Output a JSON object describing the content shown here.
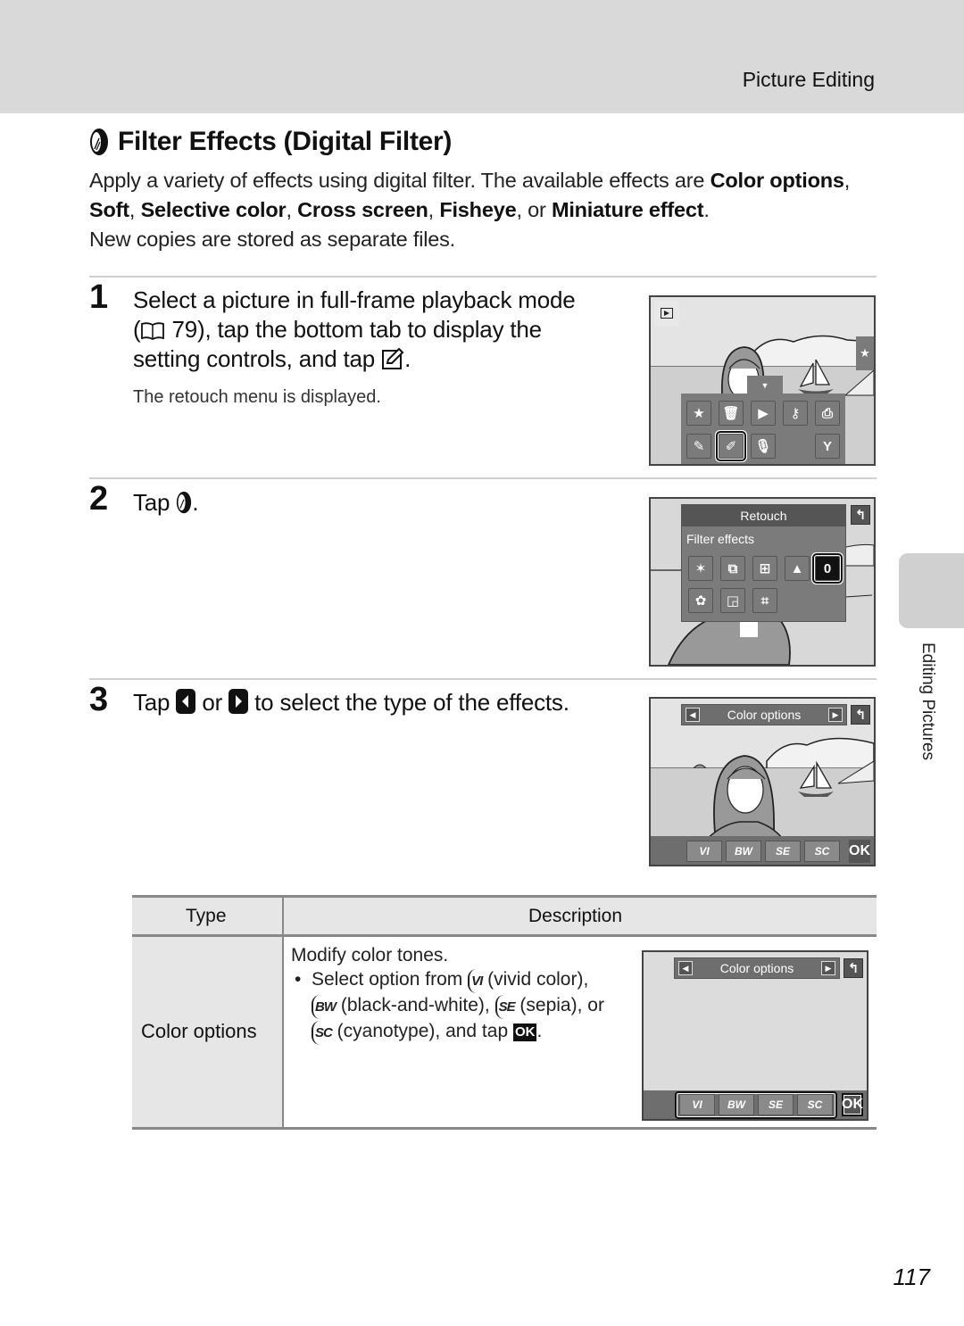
{
  "header": {
    "section_title": "Picture Editing"
  },
  "page_title": "Filter Effects (Digital Filter)",
  "intro": {
    "text_1": "Apply a variety of effects using digital filter. The available effects are ",
    "effect_1": "Color options",
    "sep_1": ", ",
    "effect_2": "Soft",
    "sep_2": ", ",
    "effect_3": "Selective color",
    "sep_3": ", ",
    "effect_4": "Cross screen",
    "sep_4": ", ",
    "effect_5": "Fisheye",
    "sep_5": ", or ",
    "effect_6": "Miniature effect",
    "end": ".",
    "text_2": "New copies are stored as separate files."
  },
  "steps": [
    {
      "number": "1",
      "line_1": "Select a picture in full-frame playback mode",
      "line_2_pre": "(",
      "line_2_ref": " 79), tap the bottom tab to display the",
      "line_3": "setting controls, and tap ",
      "line_3_end": ".",
      "note": "The retouch menu is displayed.",
      "screen": {
        "mode_icon": "playback-icon",
        "side_tab_icon": "star-icon",
        "menu_row_1": [
          "favorites-icon",
          "delete-icon",
          "slide-show-icon",
          "protect-icon",
          "print-order-icon"
        ],
        "menu_row_2": [
          "edit-icon",
          "retouch-icon",
          "voice-memo-icon",
          "setup-icon"
        ],
        "selected": "retouch-icon"
      }
    },
    {
      "number": "2",
      "text": "Tap ",
      "text_end": ".",
      "screen": {
        "menu_title": "Retouch",
        "submenu_label": "Filter effects",
        "row_1": [
          "quick-retouch-icon",
          "d-lighting-icon",
          "skin-softening-icon",
          "glamour-icon",
          "filter-effects-icon"
        ],
        "row_2": [
          "auto-paint-icon",
          "small-picture-icon",
          "crop-icon"
        ],
        "selected": "filter-effects-icon",
        "back_icon": "back-icon"
      }
    },
    {
      "number": "3",
      "text_1": "Tap ",
      "text_2": " or ",
      "text_3": " to select the type of the effects.",
      "screen": {
        "option_label": "Color options",
        "options": [
          "VI",
          "BW",
          "SE",
          "SC"
        ],
        "ok_label": "OK"
      }
    }
  ],
  "table": {
    "headers": {
      "type": "Type",
      "description": "Description"
    },
    "rows": [
      {
        "type": "Color options",
        "desc_line": "Modify color tones.",
        "bullet_1": "Select option from ",
        "opt_vi": "VI",
        "bullet_2": " (vivid color),",
        "opt_bw": "BW",
        "bullet_3": " (black-and-white), ",
        "opt_se": "SE",
        "bullet_4": " (sepia), or",
        "opt_sc": "SC",
        "bullet_5": " (cyanotype), and tap ",
        "ok": "OK",
        "bullet_end": ".",
        "screen": {
          "option_label": "Color options",
          "options": [
            "VI",
            "BW",
            "SE",
            "SC"
          ],
          "ok_label": "OK"
        }
      }
    ]
  },
  "side_tab": {
    "label": "Editing Pictures"
  },
  "page_number": "117"
}
